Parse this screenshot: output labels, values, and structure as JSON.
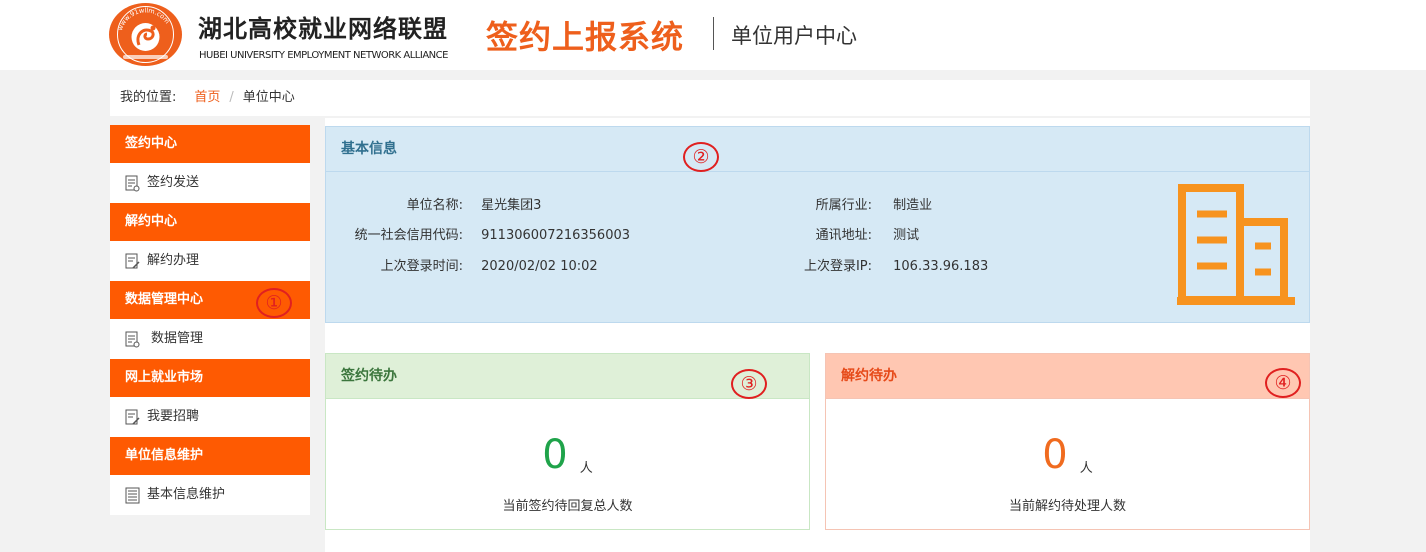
{
  "header": {
    "logo_url_text": "www.91wllm.com",
    "logo_title": "湖北高校就业网络联盟",
    "logo_subtitle": "HUBEI UNIVERSITY EMPLOYMENT NETWORK ALLIANCE",
    "system_title": "签约上报系统",
    "system_subtitle": "单位用户中心"
  },
  "breadcrumb": {
    "label": "我的位置:",
    "home": "首页",
    "separator": "/",
    "current": "单位中心"
  },
  "sidebar": {
    "groups": [
      {
        "title": "签约中心",
        "items": [
          {
            "label": "签约发送",
            "icon": "document-icon"
          }
        ]
      },
      {
        "title": "解约中心",
        "items": [
          {
            "label": "解约办理",
            "icon": "edit-document-icon"
          }
        ]
      },
      {
        "title": "数据管理中心",
        "items": [
          {
            "label": "数据管理",
            "icon": "document-icon"
          }
        ]
      },
      {
        "title": "网上就业市场",
        "items": [
          {
            "label": "我要招聘",
            "icon": "edit-document-icon"
          }
        ]
      },
      {
        "title": "单位信息维护",
        "items": [
          {
            "label": "基本信息维护",
            "icon": "list-document-icon"
          }
        ]
      }
    ]
  },
  "info": {
    "title": "基本信息",
    "left": [
      {
        "key": "单位名称:",
        "value": "星光集团3"
      },
      {
        "key": "统一社会信用代码:",
        "value": "911306007216356003"
      },
      {
        "key": "上次登录时间:",
        "value": "2020/02/02 10:02"
      }
    ],
    "right": [
      {
        "key": "所属行业:",
        "value": "制造业"
      },
      {
        "key": "通讯地址:",
        "value": "测试"
      },
      {
        "key": "上次登录IP:",
        "value": "106.33.96.183"
      }
    ],
    "icon": "building-icon"
  },
  "sign_card": {
    "title": "签约待办",
    "count": "0",
    "unit": "人",
    "desc": "当前签约待回复总人数"
  },
  "cancel_card": {
    "title": "解约待办",
    "count": "0",
    "unit": "人",
    "desc": "当前解约待处理人数"
  },
  "annotations": [
    "①",
    "②",
    "③",
    "④"
  ],
  "colors": {
    "accent": "#fe5a02",
    "info_bg": "#d6e9f5",
    "success_bg": "#dff0d8",
    "danger_bg": "#ffc7b2",
    "marker": "#e02020"
  }
}
